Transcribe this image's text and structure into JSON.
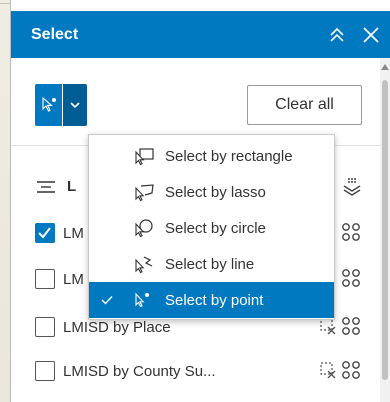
{
  "panel": {
    "title": "Select",
    "accent": "#0079c1"
  },
  "toolbar": {
    "clear_label": "Clear all",
    "active_tool_icon": "select-point-icon"
  },
  "dropdown": {
    "items": [
      {
        "label": "Select by rectangle",
        "icon": "select-rectangle-icon",
        "selected": false
      },
      {
        "label": "Select by lasso",
        "icon": "select-lasso-icon",
        "selected": false
      },
      {
        "label": "Select by circle",
        "icon": "select-circle-icon",
        "selected": false
      },
      {
        "label": "Select by line",
        "icon": "select-line-icon",
        "selected": false
      },
      {
        "label": "Select by point",
        "icon": "select-point-icon",
        "selected": true
      }
    ]
  },
  "layers": {
    "header_label": "L",
    "rows": [
      {
        "label": "LM",
        "checked": true
      },
      {
        "label": "LM",
        "checked": false
      },
      {
        "label": "LMISD by Place",
        "checked": false
      },
      {
        "label": "LMISD by County Su...",
        "checked": false
      }
    ]
  }
}
